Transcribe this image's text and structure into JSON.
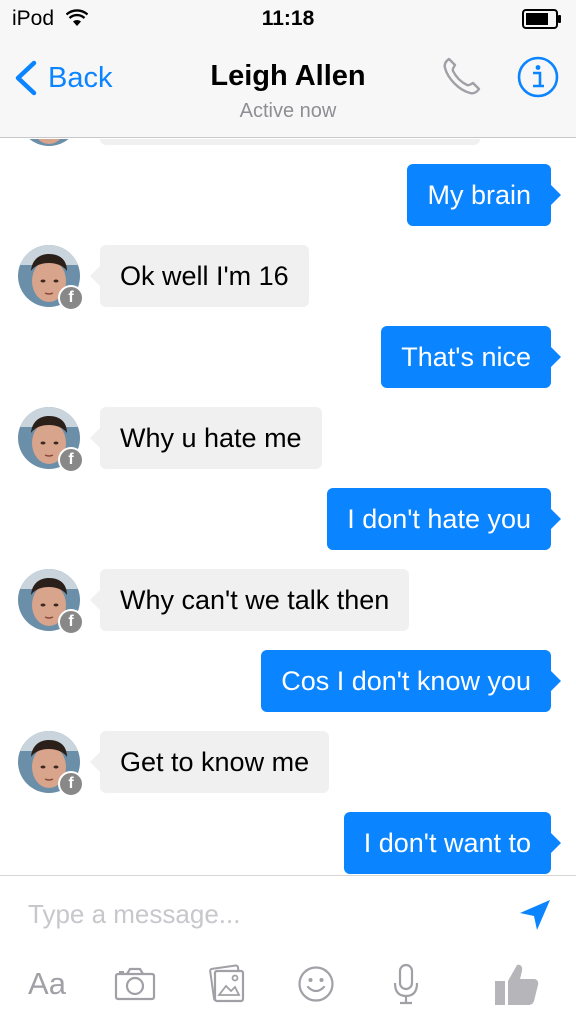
{
  "status_bar": {
    "carrier": "iPod",
    "time": "11:18"
  },
  "nav": {
    "back_label": "Back",
    "contact_name": "Leigh Allen",
    "contact_status": "Active now",
    "call_icon": "phone-icon",
    "info_icon": "info-icon"
  },
  "messages": [
    {
      "direction": "out",
      "text": "My brain"
    },
    {
      "direction": "in",
      "text": "Ok well I'm 16"
    },
    {
      "direction": "out",
      "text": "That's nice"
    },
    {
      "direction": "in",
      "text": "Why u hate me"
    },
    {
      "direction": "out",
      "text": "I don't hate you"
    },
    {
      "direction": "in",
      "text": "Why can't we talk then"
    },
    {
      "direction": "out",
      "text": "Cos I don't know you"
    },
    {
      "direction": "in",
      "text": "Get to know me"
    },
    {
      "direction": "out",
      "text": "I don't want to"
    }
  ],
  "composer": {
    "placeholder": "Type a message...",
    "text_format_label": "Aa",
    "tools": [
      "text-format",
      "camera-icon",
      "photo-gallery-icon",
      "smiley-icon",
      "microphone-icon",
      "thumbs-up-icon"
    ]
  },
  "colors": {
    "accent": "#0a84ff",
    "incoming_bubble": "#f0f0f0",
    "icon_gray": "#a0a0a6"
  }
}
